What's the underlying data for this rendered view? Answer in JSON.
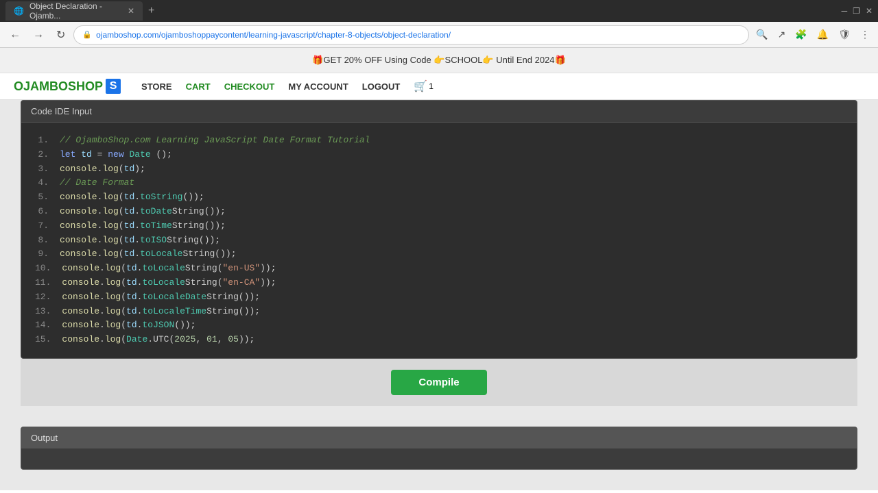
{
  "browser": {
    "tab_title": "Object Declaration - Ojamb...",
    "tab_favicon": "🌐",
    "url": "ojamboshop.com/ojamboshoppaycontent/learning-javascript/chapter-8-objects/object-declaration/",
    "new_tab_label": "+",
    "back_disabled": false,
    "forward_disabled": false
  },
  "promo": {
    "text": "🎁GET 20% OFF Using Code 👉SCHOOL👉 Until End 2024🎁"
  },
  "nav": {
    "logo_text": "OJAMBOSHOP",
    "logo_s": "S",
    "store": "STORE",
    "cart": "CART",
    "checkout": "CHECKOUT",
    "my_account": "MY ACCOUNT",
    "logout": "LOGOUT",
    "cart_count": "1"
  },
  "code_ide": {
    "header": "Code IDE Input",
    "lines": [
      {
        "num": "1.",
        "raw": "// OjamboShop.com Learning JavaScript Date Format Tutorial"
      },
      {
        "num": "2.",
        "raw": "let td = new Date();"
      },
      {
        "num": "3.",
        "raw": "console.log(td);"
      },
      {
        "num": "4.",
        "raw": "// Date Format"
      },
      {
        "num": "5.",
        "raw": "console.log(td.toString());"
      },
      {
        "num": "6.",
        "raw": "console.log(td.toDateString());"
      },
      {
        "num": "7.",
        "raw": "console.log(td.toTimeString());"
      },
      {
        "num": "8.",
        "raw": "console.log(td.toISOString());"
      },
      {
        "num": "9.",
        "raw": "console.log(td.toLocaleString());"
      },
      {
        "num": "10.",
        "raw": "console.log(td.toLocaleString(\"en-US\"));"
      },
      {
        "num": "11.",
        "raw": "console.log(td.toLocaleString(\"en-CA\"));"
      },
      {
        "num": "12.",
        "raw": "console.log(td.toLocaleDateString());"
      },
      {
        "num": "13.",
        "raw": "console.log(td.toLocaleTimeString());"
      },
      {
        "num": "14.",
        "raw": "console.log(td.toJSON());"
      },
      {
        "num": "15.",
        "raw": "console.log(Date.UTC(2025, 01, 05));"
      }
    ]
  },
  "compile_btn": "Compile",
  "output": {
    "header": "Output"
  }
}
